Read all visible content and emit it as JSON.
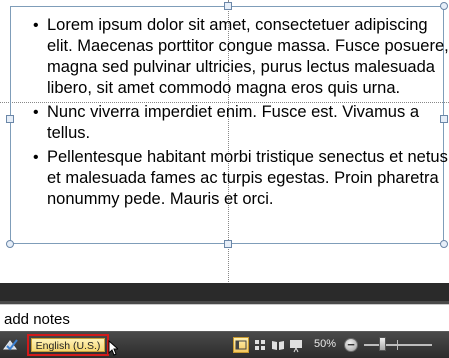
{
  "slide": {
    "bullets": [
      "Lorem ipsum dolor sit amet, consectetuer adipiscing elit. Maecenas porttitor congue massa. Fusce posuere, magna sed pulvinar ultricies, purus lectus malesuada libero, sit amet commodo magna eros quis urna.",
      "Nunc viverra imperdiet enim. Fusce est. Vivamus a tellus.",
      "Pellentesque habitant morbi tristique senectus et netus et malesuada fames ac turpis egestas. Proin pharetra nonummy pede. Mauris et orci."
    ],
    "bullet_glyph": "•"
  },
  "notes": {
    "text": "add notes"
  },
  "statusbar": {
    "language": "English (U.S.)",
    "zoom_percent": "50%",
    "zoom_out_label": "−",
    "views": [
      "normal-view",
      "slide-sorter-view",
      "reading-view",
      "slide-show-view"
    ],
    "active_view": "normal-view"
  },
  "colors": {
    "statusbar_bg": "#3a3a3a",
    "highlight_border": "#d21a1a",
    "language_bg": "#f6d872"
  }
}
